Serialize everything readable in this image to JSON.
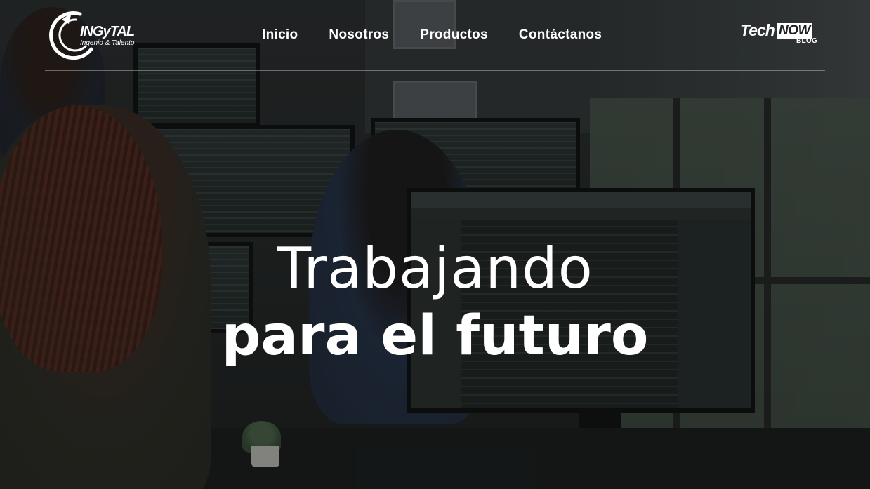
{
  "logo": {
    "name": "INGyTAL",
    "tagline": "Ingenio & Talento"
  },
  "nav": {
    "items": [
      {
        "label": "Inicio"
      },
      {
        "label": "Nosotros"
      },
      {
        "label": "Productos"
      },
      {
        "label": "Contáctanos"
      }
    ]
  },
  "blog_badge": {
    "tech": "Tech",
    "now": "NOW",
    "sub": "BLOG"
  },
  "hero": {
    "line1": "Trabajando",
    "line2": "para el futuro"
  },
  "colors": {
    "text": "#ffffff",
    "overlay": "#0c0e0e"
  }
}
